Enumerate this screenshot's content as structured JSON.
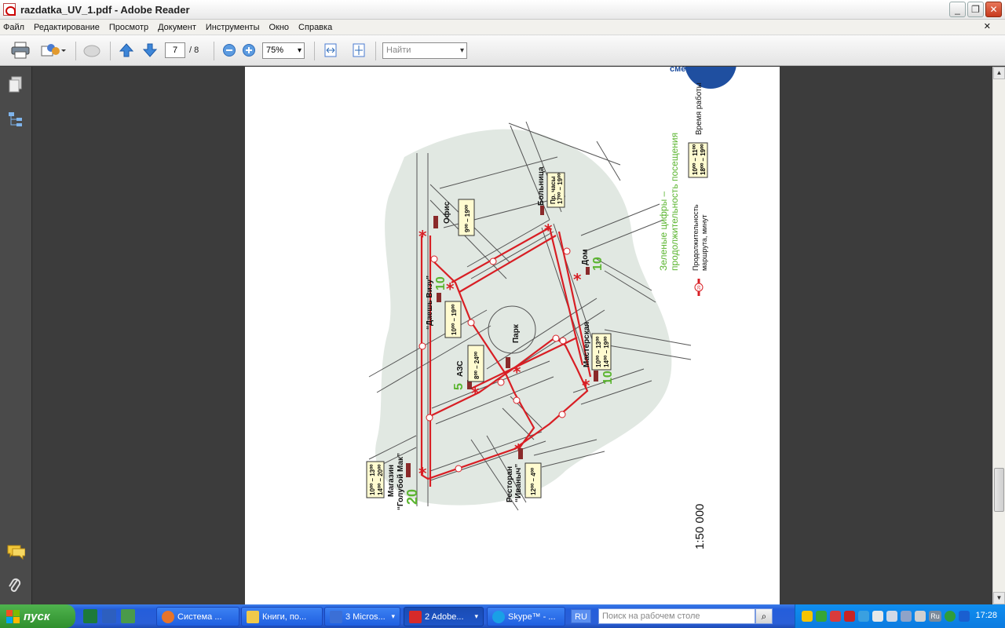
{
  "window": {
    "title": "razdatka_UV_1.pdf - Adobe Reader",
    "minimize": "_",
    "restore": "❐",
    "close": "✕"
  },
  "menu": {
    "items": [
      "Файл",
      "Редактирование",
      "Просмотр",
      "Документ",
      "Инструменты",
      "Окно",
      "Справка"
    ],
    "close": "✕"
  },
  "toolbar": {
    "page_current": "7",
    "page_total": "/ 8",
    "zoom": "75%",
    "search_placeholder": "Найти"
  },
  "map": {
    "scale": "1:50 000",
    "legend": {
      "green_digits_line1": "Зеленые цифры –",
      "green_digits_line2": "продолжительность посещения",
      "work_time": "Время работы",
      "work_time_box_line1": "10⁰⁰ – 11⁰⁰",
      "work_time_box_line2": "18⁰⁰ – 19⁰⁰",
      "route_duration_line1": "Продолжительность",
      "route_duration_line2": "маршрута, минут",
      "route_sample": "20",
      "corner_text": "смена"
    },
    "places": {
      "office": {
        "name": "Офис",
        "hours": "9⁰⁰ – 19⁰⁰"
      },
      "hospital": {
        "name": "Больница",
        "hours_line1": "Пр. часы",
        "hours_line2": "17⁰⁰ – 19⁰⁰"
      },
      "home": {
        "name": "Дом",
        "duration": "10"
      },
      "dashvizu": {
        "name": "“Даешь Визу”",
        "duration": "10",
        "hours": "10⁰⁰ – 19⁰⁰"
      },
      "park": {
        "name": "Парк"
      },
      "azs": {
        "name": "АЗС",
        "duration": "5",
        "hours": "8⁰⁰ – 24⁰⁰"
      },
      "workshop": {
        "name": "Мастерская",
        "duration": "10",
        "hours_line1": "10⁰⁰ – 13⁰⁰",
        "hours_line2": "14⁰⁰ – 19⁰⁰"
      },
      "shop": {
        "name_line1": "Магазин",
        "name_line2": "“Голубой Мак”",
        "duration": "20",
        "hours_line1": "10⁰⁰ – 13⁰⁰",
        "hours_line2": "14⁰⁰ – 20⁰⁰"
      },
      "restaurant": {
        "name_line1": "Ресторан",
        "name_line2": "“Иваныч”",
        "hours": "12⁰⁰ – 4⁰⁰"
      }
    }
  },
  "taskbar": {
    "start": "пуск",
    "tasks": [
      {
        "label": "Система ...",
        "color": "#e6742b"
      },
      {
        "label": "Книги, по...",
        "color": "#f0c94a"
      },
      {
        "label": "3 Micros...",
        "color": "#3b6fd6"
      },
      {
        "label": "2 Adobe...",
        "color": "#d62a2a"
      },
      {
        "label": "Skype™ - ...",
        "color": "#1aa0e6"
      }
    ],
    "lang": "RU",
    "search_placeholder": "Поиск на рабочем столе",
    "clock": "17:28",
    "tray_lang": "Ru"
  },
  "colors": {
    "route": "#d81e24",
    "green": "#5bb530",
    "block": "#ffffff",
    "land": "#e1e8e2"
  }
}
